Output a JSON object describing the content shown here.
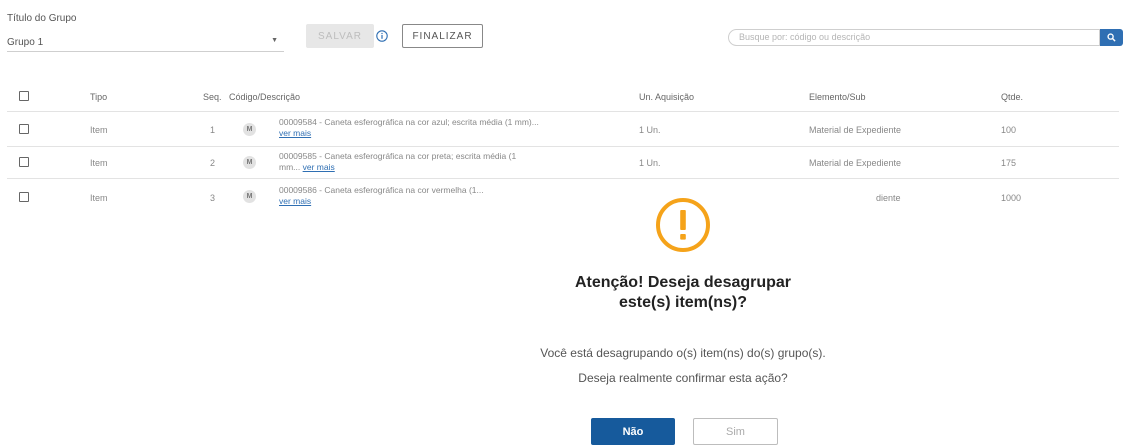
{
  "form": {
    "group_title_label": "Título do Grupo",
    "group_value": "Grupo 1",
    "save_label": "SALVAR",
    "finalize_label": "FINALIZAR",
    "search_placeholder": "Busque por: código ou descrição"
  },
  "table": {
    "headers": {
      "tipo": "Tipo",
      "seq": "Seq.",
      "codigo": "Código/Descrição",
      "un": "Un. Aquisição",
      "elemento": "Elemento/Sub",
      "qtde": "Qtde."
    },
    "rows": [
      {
        "tipo": "Item",
        "seq": "1",
        "badge": "M",
        "desc": "00009584 - Caneta esferográfica na cor azul; escrita média (1 mm)...",
        "more": "ver mais",
        "un": "1 Un.",
        "elemento": "Material de Expediente",
        "qtde": "100"
      },
      {
        "tipo": "Item",
        "seq": "2",
        "badge": "M",
        "desc": "00009585 - Caneta esferográfica na cor preta; escrita média (1 mm...",
        "more": "ver mais",
        "un": "1 Un.",
        "elemento": "Material de Expediente",
        "qtde": "175"
      },
      {
        "tipo": "Item",
        "seq": "3",
        "badge": "M",
        "desc": "00009586 - Caneta esferográfica na cor vermelha (1...",
        "more": "ver mais",
        "un": "",
        "elemento": "diente",
        "qtde": "1000"
      }
    ]
  },
  "dialog": {
    "title_line1": "Atenção! Deseja desagrupar",
    "title_line2": "este(s) item(ns)?",
    "message1": "Você está desagrupando o(s) item(ns) do(s) grupo(s).",
    "message2": "Deseja realmente confirmar esta ação?",
    "no_label": "Não",
    "yes_label": "Sim"
  },
  "colors": {
    "primary": "#165a9c",
    "warning": "#f5a31a"
  }
}
